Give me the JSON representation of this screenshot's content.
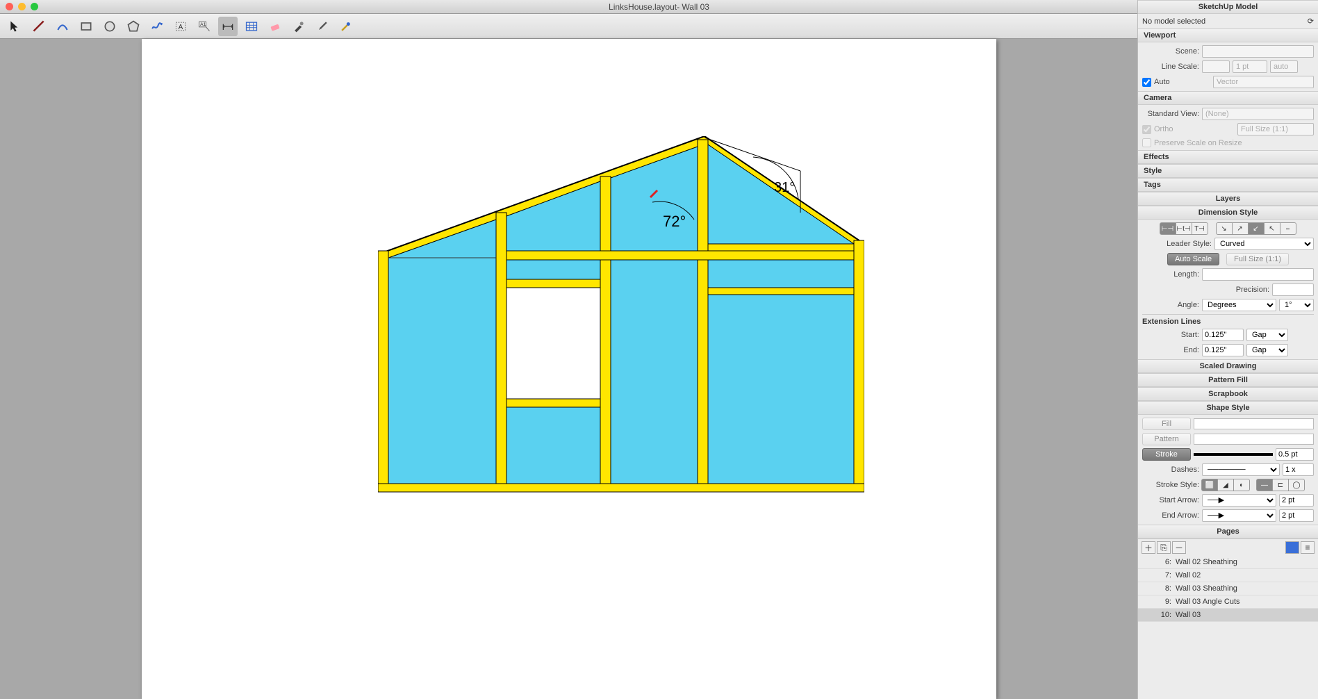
{
  "window": {
    "title": "LinksHouse.layout- Wall 03"
  },
  "toolbar": {
    "tools": [
      "select",
      "line",
      "arc",
      "rectangle",
      "circle",
      "polygon",
      "freehand",
      "text",
      "label",
      "dimension",
      "table",
      "eraser",
      "style",
      "eyedropper",
      "split"
    ]
  },
  "canvas": {
    "angle_inner": "72°",
    "angle_outer": "31°"
  },
  "inspector": {
    "model_header": "SketchUp Model",
    "no_model": "No model selected",
    "viewport_header": "Viewport",
    "scene_label": "Scene:",
    "linescale_label": "Line Scale:",
    "linescale_value": "1 pt",
    "linescale_auto": "auto",
    "auto_check": "Auto",
    "render_value": "Vector",
    "camera_header": "Camera",
    "stdview_label": "Standard View:",
    "stdview_value": "(None)",
    "ortho_check": "Ortho",
    "fullsize_label": "Full Size (1:1)",
    "preserve_check": "Preserve Scale on Resize",
    "effects_header": "Effects",
    "style_header": "Style",
    "tags_header": "Tags",
    "layers_header": "Layers",
    "dimstyle_header": "Dimension Style",
    "leader_label": "Leader Style:",
    "leader_value": "Curved",
    "autoscale_btn": "Auto Scale",
    "fullsize_btn": "Full Size (1:1)",
    "length_label": "Length:",
    "precision_label": "Precision:",
    "angle_label": "Angle:",
    "angle_unit": "Degrees",
    "angle_precision": "1°",
    "extlines_header": "Extension Lines",
    "start_label": "Start:",
    "end_label": "End:",
    "ext_value": "0.125\"",
    "gap_value": "Gap",
    "scaled_header": "Scaled Drawing",
    "pattern_header": "Pattern Fill",
    "scrapbook_header": "Scrapbook",
    "shapestyle_header": "Shape Style",
    "fill_label": "Fill",
    "pattern_label": "Pattern",
    "stroke_label": "Stroke",
    "stroke_width": "0.5 pt",
    "dashes_label": "Dashes:",
    "dashes_scale": "1 x",
    "strokestyle_label": "Stroke Style:",
    "startarrow_label": "Start Arrow:",
    "endarrow_label": "End Arrow:",
    "arrow_size": "2 pt",
    "pages_header": "Pages",
    "pages": [
      {
        "num": "6:",
        "name": "Wall 02 Sheathing"
      },
      {
        "num": "7:",
        "name": "Wall 02"
      },
      {
        "num": "8:",
        "name": "Wall 03 Sheathing"
      },
      {
        "num": "9:",
        "name": "Wall 03 Angle Cuts"
      },
      {
        "num": "10:",
        "name": "Wall 03"
      }
    ]
  }
}
